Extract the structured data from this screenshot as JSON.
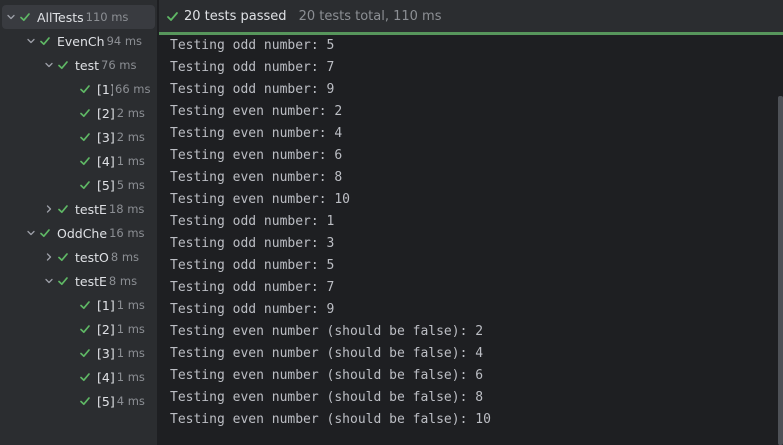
{
  "colors": {
    "pass_green": "#5fb865",
    "panel_bg": "#2b2d30",
    "console_bg": "#1e1f22",
    "status_line": "#57965c"
  },
  "tree": [
    {
      "name": "AllTests",
      "time": "110 ms",
      "chevron": "down",
      "selected": true
    },
    {
      "name": "EvenCh",
      "time": "94 ms",
      "chevron": "down",
      "selected": false
    },
    {
      "name": "test",
      "time": "76 ms",
      "chevron": "down",
      "selected": false
    },
    {
      "name": "[1]",
      "time": "66 ms",
      "chevron": "none",
      "selected": false
    },
    {
      "name": "[2]",
      "time": "2 ms",
      "chevron": "none",
      "selected": false
    },
    {
      "name": "[3]",
      "time": "2 ms",
      "chevron": "none",
      "selected": false
    },
    {
      "name": "[4]",
      "time": "1 ms",
      "chevron": "none",
      "selected": false
    },
    {
      "name": "[5]",
      "time": "5 ms",
      "chevron": "none",
      "selected": false
    },
    {
      "name": "testE",
      "time": "18 ms",
      "chevron": "right",
      "selected": false
    },
    {
      "name": "OddChe",
      "time": "16 ms",
      "chevron": "down",
      "selected": false
    },
    {
      "name": "testO",
      "time": "8 ms",
      "chevron": "right",
      "selected": false
    },
    {
      "name": "testE",
      "time": "8 ms",
      "chevron": "down",
      "selected": false
    },
    {
      "name": "[1]",
      "time": "1 ms",
      "chevron": "none",
      "selected": false
    },
    {
      "name": "[2]",
      "time": "1 ms",
      "chevron": "none",
      "selected": false
    },
    {
      "name": "[3]",
      "time": "1 ms",
      "chevron": "none",
      "selected": false
    },
    {
      "name": "[4]",
      "time": "1 ms",
      "chevron": "none",
      "selected": false
    },
    {
      "name": "[5]",
      "time": "4 ms",
      "chevron": "none",
      "selected": false
    }
  ],
  "status": {
    "passed": "20 tests passed",
    "total": "20 tests total, 110 ms"
  },
  "output": [
    "Testing odd number: 5",
    "Testing odd number: 7",
    "Testing odd number: 9",
    "Testing even number: 2",
    "Testing even number: 4",
    "Testing even number: 6",
    "Testing even number: 8",
    "Testing even number: 10",
    "Testing odd number: 1",
    "Testing odd number: 3",
    "Testing odd number: 5",
    "Testing odd number: 7",
    "Testing odd number: 9",
    "Testing even number (should be false): 2",
    "Testing even number (should be false): 4",
    "Testing even number (should be false): 6",
    "Testing even number (should be false): 8",
    "Testing even number (should be false): 10"
  ]
}
